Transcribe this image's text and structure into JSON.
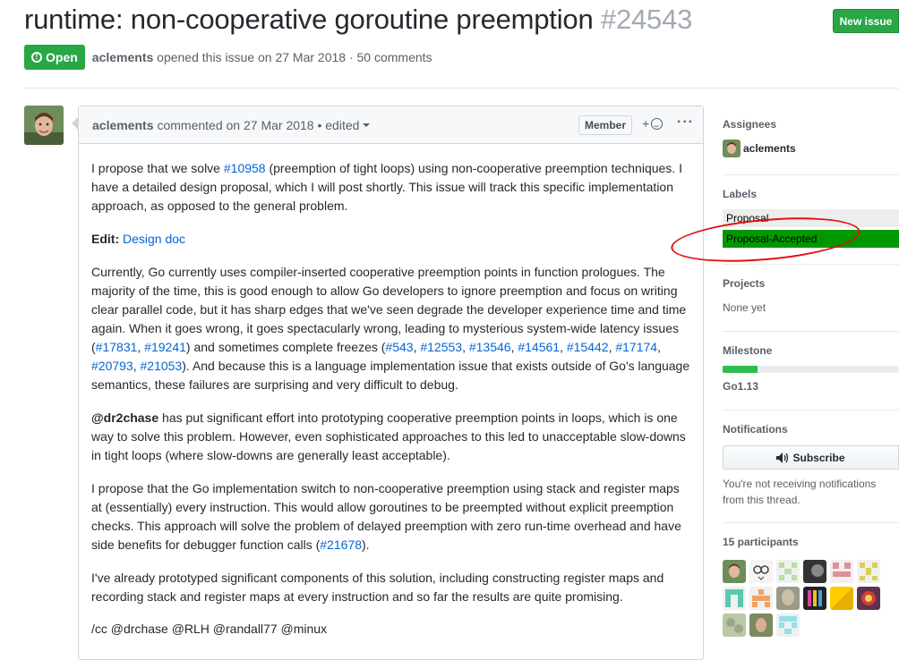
{
  "issue": {
    "title": "runtime: non-cooperative goroutine preemption",
    "number": "#24543",
    "new_issue_label": "New issue",
    "state_label": "Open",
    "author": "aclements",
    "opened_text": "opened this issue on 27 Mar 2018 · 50 comments"
  },
  "comment": {
    "author": "aclements",
    "meta": "commented on 27 Mar 2018 • edited",
    "role_badge": "Member",
    "react_plus": "+",
    "more": "···",
    "p1_a": "I propose that we solve ",
    "p1_link": "#10958",
    "p1_b": " (preemption of tight loops) using non-cooperative preemption techniques. I have a detailed design proposal, which I will post shortly. This issue will track this specific implementation approach, as opposed to the general problem.",
    "edit_label": "Edit:",
    "edit_link": "Design doc",
    "p3_a": "Currently, Go currently uses compiler-inserted cooperative preemption points in function prologues. The majority of the time, this is good enough to allow Go developers to ignore preemption and focus on writing clear parallel code, but it has sharp edges that we've seen degrade the developer experience time and time again. When it goes wrong, it goes spectacularly wrong, leading to mysterious system-wide latency issues (",
    "p3_l1": "#17831",
    "p3_l2": "#19241",
    "p3_b": ") and sometimes complete freezes (",
    "p3_l3": "#543",
    "p3_l4": "#12553",
    "p3_l5": "#13546",
    "p3_l6": "#14561",
    "p3_l7": "#15442",
    "p3_l8": "#17174",
    "p3_l9": "#20793",
    "p3_l10": "#21053",
    "p3_c": "). And because this is a language implementation issue that exists outside of Go's language semantics, these failures are surprising and very difficult to debug.",
    "p4_mention": "@dr2chase",
    "p4_text": " has put significant effort into prototyping cooperative preemption points in loops, which is one way to solve this problem. However, even sophisticated approaches to this led to unacceptable slow-downs in tight loops (where slow-downs are generally least acceptable).",
    "p5_a": "I propose that the Go implementation switch to non-cooperative preemption using stack and register maps at (essentially) every instruction. This would allow goroutines to be preempted without explicit preemption checks. This approach will solve the problem of delayed preemption with zero run-time overhead and have side benefits for debugger function calls (",
    "p5_link": "#21678",
    "p5_b": ").",
    "p6": "I've already prototyped significant components of this solution, including constructing register maps and recording stack and register maps at every instruction and so far the results are quite promising.",
    "p7": "/cc @drchase @RLH @randall77 @minux"
  },
  "sidebar": {
    "assignees_title": "Assignees",
    "assignee": "aclements",
    "labels_title": "Labels",
    "labels": [
      {
        "name": "Proposal",
        "color": "#ededed"
      },
      {
        "name": "Proposal-Accepted",
        "color": "#009800"
      }
    ],
    "projects_title": "Projects",
    "projects_value": "None yet",
    "milestone_title": "Milestone",
    "milestone_value": "Go1.13",
    "milestone_progress": 0.2,
    "notifications_title": "Notifications",
    "subscribe_label": "Subscribe",
    "notif_text": "You're not receiving notifications from this thread.",
    "participants_title": "15 participants"
  }
}
